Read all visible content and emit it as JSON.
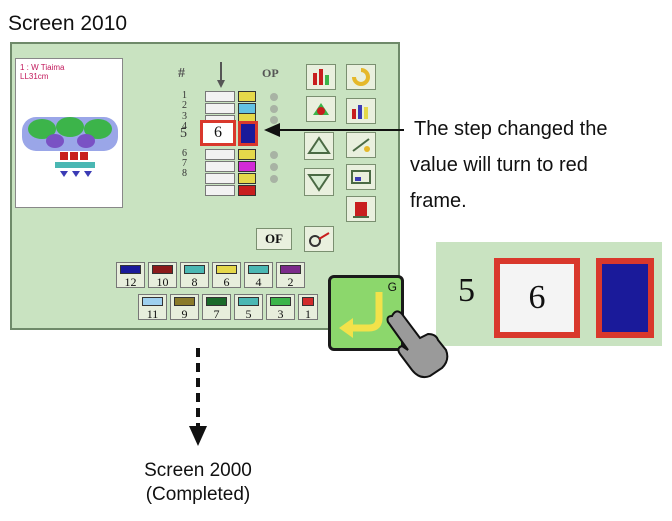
{
  "screen_title": "Screen 2010",
  "preview": {
    "line1": "1 : W Tiaima",
    "line2": "LL31cm"
  },
  "table": {
    "header_hash": "#",
    "header_op": "OP",
    "row_numbers": [
      "1",
      "2",
      "3",
      "4",
      "5",
      "6",
      "7",
      "8"
    ],
    "selected_value": "6",
    "colors": [
      "#e5d84a",
      "#63c1e3",
      "#e5d84a",
      "#1a1a9a",
      "#e5d84a",
      "#d12bd6",
      "#e5d84a",
      "#c81e1e"
    ]
  },
  "of_label": "OF",
  "palette": {
    "row1": [
      {
        "label": "12",
        "color": "#1a1a9a"
      },
      {
        "label": "10",
        "color": "#8b1a1a"
      },
      {
        "label": "8",
        "color": "#4ab7b3"
      },
      {
        "label": "6",
        "color": "#e5d84a"
      },
      {
        "label": "4",
        "color": "#4ab7b3"
      },
      {
        "label": "2",
        "color": "#7b2a8a"
      }
    ],
    "row2": [
      {
        "label": "11",
        "color": "#9ed0ef"
      },
      {
        "label": "9",
        "color": "#8a7a2a"
      },
      {
        "label": "7",
        "color": "#1a6a2a"
      },
      {
        "label": "5",
        "color": "#4ab7b3"
      },
      {
        "label": "3",
        "color": "#3cb44a"
      },
      {
        "label": "1",
        "color": "#d12b2b"
      }
    ]
  },
  "annotation": {
    "line1": "The step changed the",
    "line2": "value will turn to red",
    "line3": "frame."
  },
  "zoom": {
    "step": "5",
    "value": "6",
    "color": "#1a1a9a"
  },
  "g_button": {
    "letter": "G"
  },
  "bottom": {
    "line1": "Screen 2000",
    "line2": "(Completed)"
  }
}
